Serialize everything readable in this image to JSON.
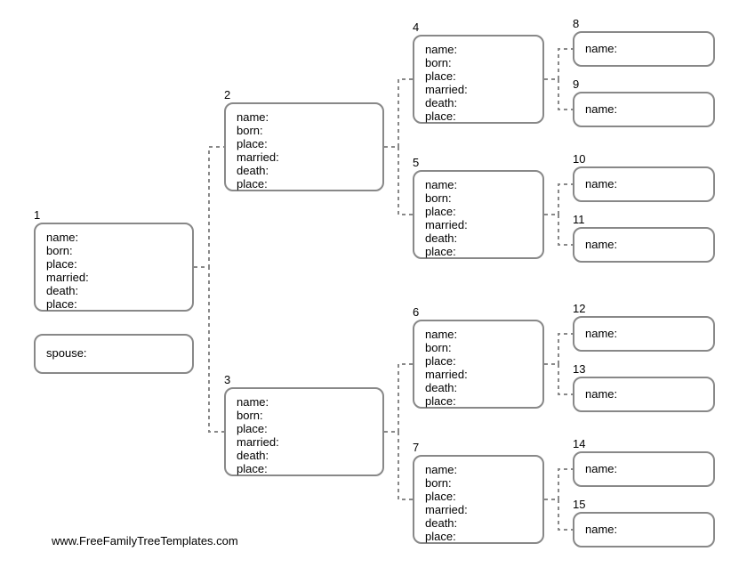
{
  "labels": {
    "name": "name:",
    "born": "born:",
    "place": "place:",
    "married": "married:",
    "death": "death:",
    "spouse": "spouse:"
  },
  "numbers": {
    "n1": "1",
    "n2": "2",
    "n3": "3",
    "n4": "4",
    "n5": "5",
    "n6": "6",
    "n7": "7",
    "n8": "8",
    "n9": "9",
    "n10": "10",
    "n11": "11",
    "n12": "12",
    "n13": "13",
    "n14": "14",
    "n15": "15"
  },
  "footer": "www.FreeFamilyTreeTemplates.com"
}
